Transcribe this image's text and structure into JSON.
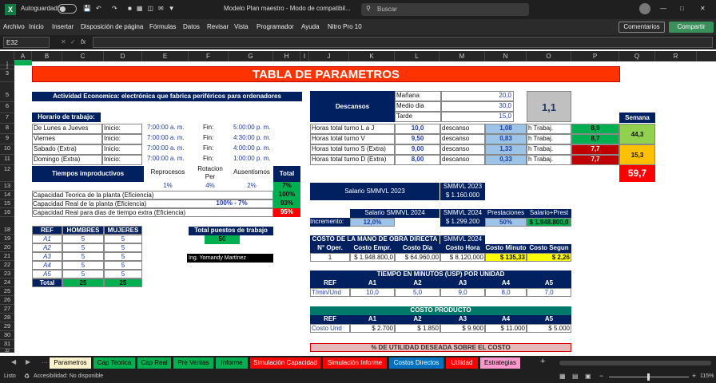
{
  "title": {
    "autosave": "Autoguardado",
    "filename": "Modelo Plan maestro - Modo de compatibil...",
    "search": "Buscar"
  },
  "ribbon": {
    "tabs": [
      "Archivo",
      "Inicio",
      "Insertar",
      "Disposición de página",
      "Fórmulas",
      "Datos",
      "Revisar",
      "Vista",
      "Programador",
      "Ayuda",
      "Nitro Pro 10"
    ],
    "comments": "Comentarios",
    "share": "Compartir"
  },
  "formula": {
    "namebox": "E32",
    "fx": "fx"
  },
  "cols": [
    "A",
    "B",
    "C",
    "D",
    "E",
    "F",
    "G",
    "H",
    "I",
    "J",
    "K",
    "L",
    "M",
    "N",
    "O",
    "P",
    "Q",
    "R"
  ],
  "rows": [
    "1",
    "2",
    "3",
    "5",
    "6",
    "7",
    "8",
    "9",
    "10",
    "11",
    "12",
    "13",
    "14",
    "15",
    "16",
    "18",
    "19",
    "20",
    "21",
    "22",
    "23",
    "24",
    "25",
    "26",
    "27",
    "28",
    "29",
    "30",
    "31",
    "32"
  ],
  "sheet": {
    "title": "TABLA DE PARAMETROS",
    "actividad": "Actividad Economica: electrónica que fabrica periféricos para ordenadores",
    "horario": "Horario de trabajo:",
    "dias": [
      {
        "d": "De Lunes a Jueves",
        "i": "Inicio:",
        "ih": "7:00:00 a. m.",
        "f": "Fin:",
        "fh": "5:00:00 p. m."
      },
      {
        "d": "Viernes",
        "i": "Inicio:",
        "ih": "7:00:00 a. m.",
        "f": "Fin:",
        "fh": "4:30:00 p. m."
      },
      {
        "d": "Sabado  (Extra)",
        "i": "Inicio:",
        "ih": "7:00:00 a. m.",
        "f": "Fin:",
        "fh": "4:00:00 p. m."
      },
      {
        "d": "Domingo  (Extra)",
        "i": "Inicio:",
        "ih": "7:00:00 a. m.",
        "f": "Fin:",
        "fh": "1:00:00 p. m."
      }
    ],
    "tiempos": "Tiempos improductivos",
    "reprocesos": "Reprocesos",
    "rotacion": "Rotacion Per",
    "ausentismos": "Ausentismos",
    "total": "Total",
    "rep_v": "1%",
    "rot_v": "4%",
    "aus_v": "2%",
    "tot_v": "7%",
    "cap_teo": "Capacidad Teorica de la planta (Eficiencia)",
    "cap_teo_v": "100%",
    "cap_real": "Capacidad Real de la planta  (Eficiencia)",
    "cap_real_f": "100% - 7%",
    "cap_real_v": "93%",
    "cap_extra": "Capacidad Real para dias de tiempo extra (Eficiencia)",
    "cap_extra_v": "95%",
    "ref": "REF",
    "hombres": "HOMBRES",
    "mujeres": "MUJERES",
    "refs": [
      {
        "r": "A1",
        "h": "5",
        "m": "5"
      },
      {
        "r": "A2",
        "h": "5",
        "m": "5"
      },
      {
        "r": "A3",
        "h": "5",
        "m": "5"
      },
      {
        "r": "A4",
        "h": "5",
        "m": "5"
      },
      {
        "r": "A5",
        "h": "5",
        "m": "5"
      }
    ],
    "total_label": "Total",
    "total_h": "25",
    "total_m": "25",
    "puestos": "Total puestos de trabajo",
    "puestos_v": "50",
    "ing": "Ing. Yornandy Martínez",
    "descansos": "Descansos",
    "manana": "Mañana",
    "manana_v": "20,0",
    "medio": "Medio dia",
    "medio_v": "30,0",
    "tarde": "Tarde",
    "tarde_v": "15,0",
    "ratio": "1,1",
    "semana": "Semana",
    "turnos": [
      {
        "l": "Horas total turno L a J",
        "v": "10,0",
        "d": "descanso",
        "dv": "1,08",
        "h": "h Trabaj.",
        "hv": "8,9"
      },
      {
        "l": "Horas total turno V",
        "v": "9,50",
        "d": "descanso",
        "dv": "0,83",
        "h": "h Trabaj.",
        "hv": "8,7"
      },
      {
        "l": "Horas total turno S (Extra)",
        "v": "9,00",
        "d": "descanso",
        "dv": "1,33",
        "h": "h Trabaj.",
        "hv": "7,7"
      },
      {
        "l": "Horas total turno D (Extra)",
        "v": "8,00",
        "d": "descanso",
        "dv": "0,33",
        "h": "h Trabaj.",
        "hv": "7,7"
      }
    ],
    "sem1": "44,3",
    "sem2": "15,3",
    "sem_tot": "59,7",
    "smmvl23": "Salario SMMVL 2023",
    "smmvl23_h": "SMMVL 2023",
    "smmvl23_v": "$ 1.160.000",
    "smmvl24": "Salario SMMVL 2024",
    "smmvl24_h": "SMMVL 2024",
    "smmvl24_v": "$ 1.299.200",
    "incremento": "Incremento:",
    "incremento_v": "12,0%",
    "prestaciones": "Prestaciones",
    "prestaciones_v": "50%",
    "salprest": "Salario+Prest",
    "salprest_v": "$ 1.948.800,0",
    "costo_mo": "COSTO DE LA MANO DE OBRA DIRECTA",
    "costo_mo_h": "SMMVL 2024",
    "mo_heads": [
      "N° Oper.",
      "Costo Empr.",
      "Costo Dia",
      "Costo Hora",
      "Costo Minuto",
      "Costo Segun"
    ],
    "mo_vals": [
      "1",
      "$ 1.948.800,0",
      "$ 64.960,00",
      "$ 8.120,000",
      "$ 135,33",
      "$ 2,26"
    ],
    "tiempo_title": "TIEMPO EN MINUTOS (USP) POR UNIDAD",
    "tiempo_heads": [
      "REF",
      "A1",
      "A2",
      "A3",
      "A4",
      "A5"
    ],
    "tiempo_vals": [
      "T/min/Und",
      "10,0",
      "5,0",
      "9,0",
      "8,0",
      "7,0"
    ],
    "costo_title": "COSTO PRODUCTO",
    "costo_heads": [
      "REF",
      "A1",
      "A2",
      "A3",
      "A4",
      "A5"
    ],
    "costo_vals": [
      "Costo Und",
      "$ 2.700",
      "$ 1.850",
      "$ 9.900",
      "$ 11.000",
      "$ 5.000"
    ],
    "utilidad_title": "% DE UTILIDAD DESEADA SOBRE EL COSTO"
  },
  "tabs": [
    {
      "name": "Parametros",
      "bg": "#fff2cc",
      "fg": "#000"
    },
    {
      "name": "Cap Teorica",
      "bg": "#00b050",
      "fg": "#000"
    },
    {
      "name": "Cap Real",
      "bg": "#00b050",
      "fg": "#000"
    },
    {
      "name": "Pre Ventas",
      "bg": "#00b050",
      "fg": "#000"
    },
    {
      "name": "Informe",
      "bg": "#00b050",
      "fg": "#000"
    },
    {
      "name": "Simulación Capacidad",
      "bg": "#ff0000",
      "fg": "#fff"
    },
    {
      "name": "Simulación Informe",
      "bg": "#ff0000",
      "fg": "#fff"
    },
    {
      "name": "Costos Directos",
      "bg": "#0070c0",
      "fg": "#fff"
    },
    {
      "name": "Utilidad",
      "bg": "#ff0000",
      "fg": "#fff"
    },
    {
      "name": "Estrategias",
      "bg": "#ff99cc",
      "fg": "#000"
    }
  ],
  "status": {
    "ready": "Listo",
    "access": "Accesibilidad: No disponible",
    "zoom": "115%"
  }
}
